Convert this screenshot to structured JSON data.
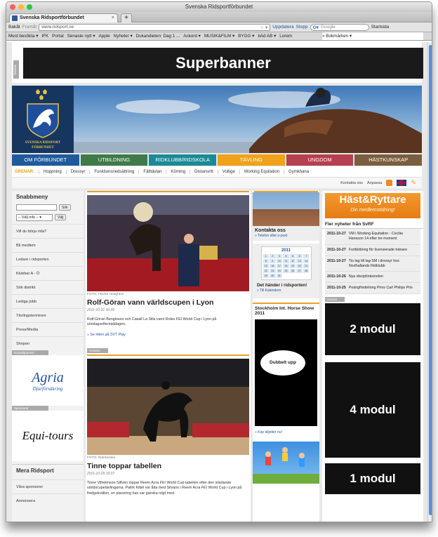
{
  "browser": {
    "window_title": "Svenska Ridsportförbundet",
    "tab_label": "Svenska Ridsportförbundet",
    "new_tab": "+",
    "back": "Bakåt",
    "forward": "Framåt",
    "url": "www.ridsport.se",
    "reload": "Uppdatera",
    "stop": "Stopp",
    "search_placeholder": "Google",
    "home": "Startsida",
    "bookmarks": [
      "Mest besökta ▾",
      "IFK",
      "Portal",
      "Senaste nytt ▾",
      "Apple",
      "Nyheter ▾",
      "Dukandieten: Dag 1 ...",
      "Ackord ▾",
      "MUSIK&FILM ▾",
      "BYGG ▾",
      "bAd AB ▾",
      "Lorem"
    ],
    "bookmarks_menu": "» Bokmärken ▾"
  },
  "ads": {
    "annons": "Annons",
    "superbanner": "Superbanner",
    "modul2": "2 modul",
    "modul4": "4 modul",
    "modul1": "1 modul",
    "dubbelt": "Dubbelt upp"
  },
  "hero": {
    "org_line1": "SVENSKA RIDSPORT",
    "org_line2": "FÖRBUNDET"
  },
  "mainnav": [
    {
      "label": "OM FÖRBUNDET",
      "color": "#1f5a9c"
    },
    {
      "label": "UTBILDNING",
      "color": "#3f7a48"
    },
    {
      "label": "RIDKLUBB/RIDSKOLA",
      "color": "#1a8a96"
    },
    {
      "label": "TÄVLING",
      "color": "#f0a21a"
    },
    {
      "label": "UNGDOM",
      "color": "#b5404f"
    },
    {
      "label": "HÄSTKUNSKAP",
      "color": "#7b5e3f"
    }
  ],
  "subnav": {
    "label": "GRENAR:",
    "items": [
      "Hoppning",
      "Dressyr",
      "Funktionsnedsättning",
      "Fälttävlan",
      "Körning",
      "Distansritt",
      "Voltige",
      "Working Equitation",
      "Gymkhana"
    ]
  },
  "util": {
    "contact": "Kontakta oss",
    "adapt": "Anpassa"
  },
  "left": {
    "title": "Snabbmeny",
    "search_btn": "Sök",
    "select_value": "– Välj info –",
    "select_btn": "Välj",
    "menu": [
      "Vill du börja rida?",
      "Bli medlem",
      "Ledare i ridsporten",
      "Klubbar A - Ö",
      "Sök distrikt",
      "Lediga jobb",
      "Tävlingsterminen",
      "Press/Media",
      "Shopen"
    ],
    "huvudsponsor": "Huvudsponsor",
    "sponsorer": "Sponsorer",
    "agria": "Agria",
    "agria_sub": "Djurförsäkring",
    "equitours": "Equi-tours",
    "mera_title": "Mera Ridsport",
    "mera": [
      "Våra sponsorer",
      "Annonsera"
    ]
  },
  "center": {
    "a1": {
      "caption": "FOTO: FEI/Kit Houghton",
      "title": "Rolf-Göran vann världscupen i Lyon",
      "date": "2011-10-31 10:20",
      "body": "Rolf-Göran Bengtsson och Casall La Silla vann Rolex FEI World Cup i Lyon på söndagseftermiddagen.",
      "link": "» Se ritten på SVT Play"
    },
    "a2": {
      "caption": "FOTO: Ridehesten",
      "title": "Tinne toppar tabellen",
      "date": "2011-10-29 19:37",
      "body": "Tinne Vilhelmson-Silfvén toppar Reem Acra FEI World Cup-tabellen efter den inledande världscupetävlingarna. Patrik Kittel var åtta med Silvano i Reem Acra FEI World Cup i Lyon på fredgskvällen, en placering han var ganska nöjd med."
    }
  },
  "mid": {
    "kontakt_title": "Kontakta oss",
    "kontakt_link": "» Telefon eller e-post",
    "cal_year": "2011",
    "cal_days": [
      "1",
      "2",
      "3",
      "4",
      "5",
      "6",
      "7",
      "8",
      "9",
      "10",
      "11",
      "12",
      "13",
      "14",
      "15",
      "16",
      "17",
      "18",
      "19",
      "20",
      "21",
      "22",
      "23",
      "24",
      "25",
      "26",
      "27",
      "28",
      "29",
      "30",
      "31"
    ],
    "cal_title": "Det händer i ridsporten!",
    "cal_link": "» Till Kalendern",
    "stock_title": "Stockholm Int. Horse Show 2011",
    "stock_link": "» Köp biljetter nu!"
  },
  "right": {
    "hast_title": "Häst&Ryttare",
    "hast_sub": "Din medlemstidning!",
    "fler_title": "Fler nyheter från SvRF",
    "news": [
      {
        "date": "2011-10-27",
        "text": "VM i Working Equitation - Cecilia Hansson 14 efter tre moment"
      },
      {
        "date": "2011-10-27",
        "text": "Fortbildning för licensierade tränare"
      },
      {
        "date": "2011-10-27",
        "text": "Tio lag till lag-SM i dressyr hos Northallands Ridklubb"
      },
      {
        "date": "2011-10-26",
        "text": "Nya disciplinärenden"
      },
      {
        "date": "2011-10-25",
        "text": "Poängfördelning Prins Carl Philips Pris"
      }
    ]
  }
}
